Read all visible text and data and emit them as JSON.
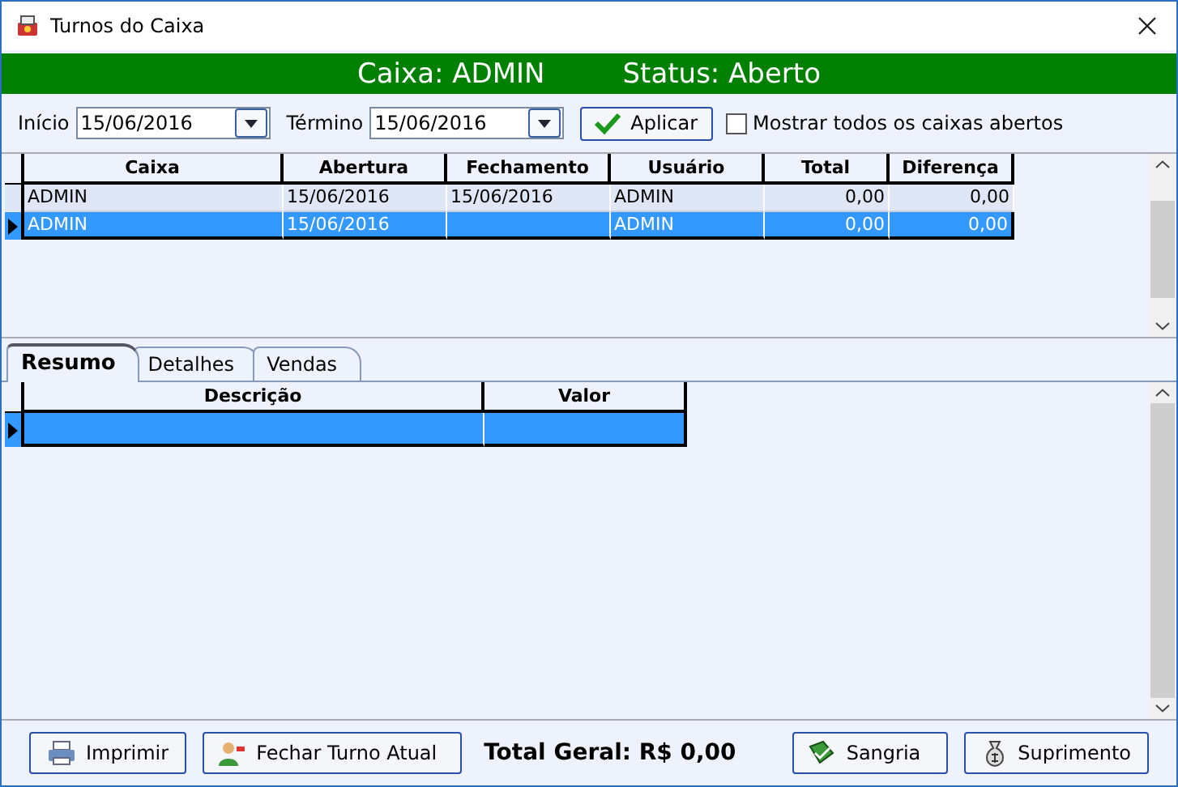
{
  "window": {
    "title": "Turnos do Caixa"
  },
  "header": {
    "caixa": "Caixa: ADMIN",
    "status": "Status: Aberto"
  },
  "filters": {
    "start_label": "Início",
    "start_value": "15/06/2016",
    "end_label": "Término",
    "end_value": "15/06/2016",
    "apply_button": "Aplicar",
    "show_all": {
      "label": "Mostrar todos os caixas abertos",
      "checked": false
    }
  },
  "shifts_table": {
    "columns": [
      "Caixa",
      "Abertura",
      "Fechamento",
      "Usuário",
      "Total",
      "Diferença"
    ],
    "rows": [
      {
        "cells": [
          "ADMIN",
          "15/06/2016",
          "15/06/2016",
          "ADMIN",
          "0,00",
          "0,00"
        ],
        "selected": false
      },
      {
        "cells": [
          "ADMIN",
          "15/06/2016",
          "",
          "ADMIN",
          "0,00",
          "0,00"
        ],
        "selected": true
      }
    ]
  },
  "tabs": [
    {
      "label": "Resumo",
      "selected": true
    },
    {
      "label": "Detalhes",
      "selected": false
    },
    {
      "label": "Vendas",
      "selected": false
    }
  ],
  "summary_table": {
    "columns": [
      "Descrição",
      "Valor"
    ],
    "rows": [
      {
        "cells": [
          "",
          ""
        ],
        "selected": true
      }
    ]
  },
  "footer": {
    "print_button": "Imprimir",
    "close_shift_button": "Fechar Turno Atual",
    "total": "Total Geral: R$ 0,00",
    "sangria_button": "Sangria",
    "suprimento_button": "Suprimento"
  }
}
